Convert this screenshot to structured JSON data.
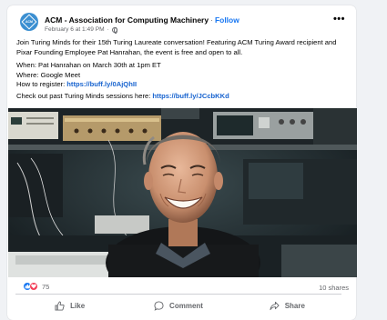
{
  "post": {
    "org_name": "ACM - Association for Computing Machinery",
    "separator": "·",
    "follow_label": "Follow",
    "date": "February 6 at 1:49 PM",
    "meta_separator": "·",
    "more_label": "•••",
    "avatar_text": "ACM",
    "body_line1": "Join Turing Minds for their 15th Turing Laureate conversation! Featuring ACM Turing Award recipient and Pixar Founding Employee Pat Hanrahan, the event is free and open to all.",
    "when": "When: Pat Hanrahan on March 30th at 1pm ET",
    "where": "Where: Google Meet",
    "register_prefix": "How to register: ",
    "register_link": "https://buff.ly/0AjQhII",
    "past_prefix": "Check out past Turing Minds sessions here: ",
    "past_link": "https://buff.ly/JCcbKKd"
  },
  "engagement": {
    "reaction_count": "75",
    "shares": "10 shares"
  },
  "actions": {
    "like": "Like",
    "comment": "Comment",
    "share": "Share"
  },
  "colors": {
    "accent": "#1877f2",
    "link": "#1763cf",
    "love": "#f33e58"
  },
  "icons": [
    "acm-logo-icon",
    "globe-icon",
    "more-icon",
    "like-reaction-icon",
    "love-reaction-icon",
    "like-icon",
    "comment-icon",
    "share-icon"
  ]
}
